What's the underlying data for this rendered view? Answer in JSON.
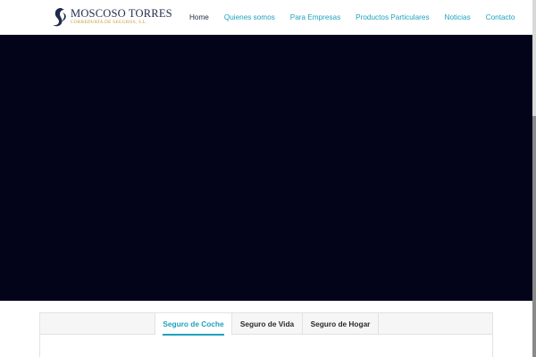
{
  "brand": {
    "name": "MOSCOSO TORRES",
    "tagline": "CORREDURÍA DE SEGUROS, S.L.",
    "color_primary": "#1f2a4d",
    "color_gold": "#c59a2e"
  },
  "nav": {
    "items": [
      {
        "label": "Home",
        "active": true
      },
      {
        "label": "Quienes somos",
        "active": false
      },
      {
        "label": "Para Empresas",
        "active": false
      },
      {
        "label": "Productos Particulares",
        "active": false
      },
      {
        "label": "Noticias",
        "active": false
      },
      {
        "label": "Contacto",
        "active": false
      }
    ],
    "accent_color": "#1fa1bd"
  },
  "hero": {
    "background_color": "#03031a"
  },
  "tabs": {
    "items": [
      {
        "label": "Seguro de Coche",
        "active": true
      },
      {
        "label": "Seguro de Vida",
        "active": false
      },
      {
        "label": "Seguro de Hogar",
        "active": false
      }
    ]
  }
}
